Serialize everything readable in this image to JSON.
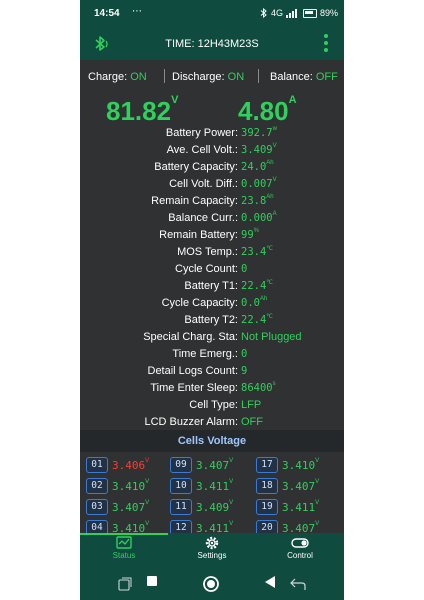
{
  "statusbar": {
    "time": "14:54",
    "dots": "⋯",
    "net": "4G",
    "battery": "89%"
  },
  "appbar": {
    "title": "TIME: 12H43M23S"
  },
  "status": {
    "charge_label": "Charge:",
    "charge_value": "ON",
    "discharge_label": "Discharge:",
    "discharge_value": "ON",
    "balance_label": "Balance:",
    "balance_value": "OFF"
  },
  "voltage": {
    "value": "81.82",
    "unit": "V"
  },
  "current": {
    "value": "4.80",
    "unit": "A"
  },
  "params": [
    {
      "label": "Battery Power:",
      "value": "392.7",
      "unit": "w"
    },
    {
      "label": "Ave. Cell Volt.:",
      "value": "3.409",
      "unit": "V"
    },
    {
      "label": "Battery Capacity:",
      "value": "24.0",
      "unit": "Ah"
    },
    {
      "label": "Cell Volt. Diff.:",
      "value": "0.007",
      "unit": "V"
    },
    {
      "label": "Remain Capacity:",
      "value": "23.8",
      "unit": "Ah"
    },
    {
      "label": "Balance Curr.:",
      "value": "0.000",
      "unit": "A"
    },
    {
      "label": "Remain Battery:",
      "value": "99",
      "unit": "%"
    },
    {
      "label": "MOS Temp.:",
      "value": "23.4",
      "unit": "℃"
    },
    {
      "label": "Cycle Count:",
      "value": "0",
      "unit": ""
    },
    {
      "label": "Battery T1:",
      "value": "22.4",
      "unit": "℃"
    },
    {
      "label": "Cycle Capacity:",
      "value": "0.0",
      "unit": "Ah"
    },
    {
      "label": "Battery T2:",
      "value": "22.4",
      "unit": "℃"
    },
    {
      "label": "Special Charg. Sta:",
      "value": "Not Plugged",
      "unit": ""
    },
    {
      "label": "Time Emerg.:",
      "value": "0",
      "unit": ""
    },
    {
      "label": "Detail Logs Count:",
      "value": "9",
      "unit": ""
    },
    {
      "label": "Time Enter Sleep:",
      "value": "86400",
      "unit": "s"
    },
    {
      "label": "Cell Type:",
      "value": "LFP",
      "unit": ""
    },
    {
      "label": "LCD Buzzer Alarm:",
      "value": "OFF",
      "unit": ""
    }
  ],
  "cells_title": "Cells Voltage",
  "cells": [
    {
      "id": "01",
      "value": "3.406",
      "unit": "V",
      "low": true
    },
    {
      "id": "09",
      "value": "3.407",
      "unit": "V"
    },
    {
      "id": "17",
      "value": "3.410",
      "unit": "V"
    },
    {
      "id": "02",
      "value": "3.410",
      "unit": "V"
    },
    {
      "id": "10",
      "value": "3.411",
      "unit": "V"
    },
    {
      "id": "18",
      "value": "3.407",
      "unit": "V"
    },
    {
      "id": "03",
      "value": "3.407",
      "unit": "V"
    },
    {
      "id": "11",
      "value": "3.409",
      "unit": "V"
    },
    {
      "id": "19",
      "value": "3.411",
      "unit": "V"
    },
    {
      "id": "04",
      "value": "3.410",
      "unit": "V"
    },
    {
      "id": "12",
      "value": "3.411",
      "unit": "V"
    },
    {
      "id": "20",
      "value": "3.407",
      "unit": "V"
    }
  ],
  "tabs": [
    {
      "label": "Status",
      "icon": "status-chart-icon",
      "active": true
    },
    {
      "label": "Settings",
      "icon": "gear-icon",
      "active": false
    },
    {
      "label": "Control",
      "icon": "toggle-icon",
      "active": false
    }
  ],
  "colors": {
    "accent": "#2ed15b",
    "bar": "#0f4b3e",
    "background": "#2f3132",
    "alert": "#ff3b30"
  }
}
